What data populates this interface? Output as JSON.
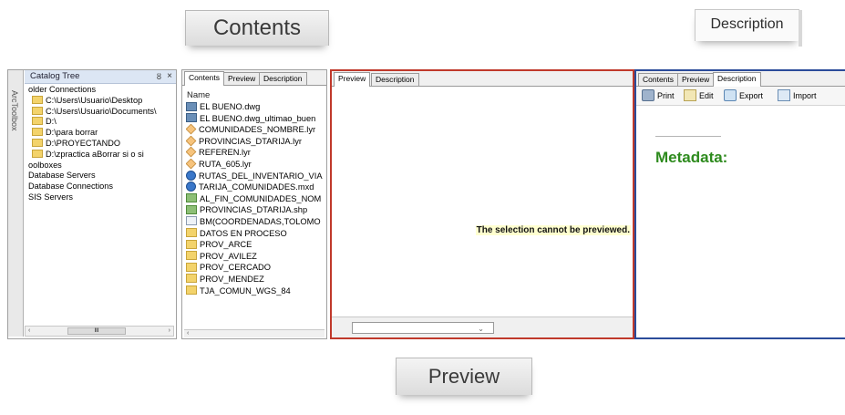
{
  "zoomed_labels": {
    "contents": "Contents",
    "description": "Description",
    "preview": "Preview"
  },
  "catalog": {
    "toolbox_label": "ArcToolbox",
    "title": "Catalog Tree",
    "pin": "ȣ",
    "close": "×",
    "items": [
      {
        "label": "older Connections",
        "icon": "none"
      },
      {
        "label": "C:\\Users\\Usuario\\Desktop",
        "icon": "folder-icon"
      },
      {
        "label": "C:\\Users\\Usuario\\Documents\\",
        "icon": "folder-icon"
      },
      {
        "label": "D:\\",
        "icon": "folder-icon"
      },
      {
        "label": "D:\\para borrar",
        "icon": "folder-icon"
      },
      {
        "label": "D:\\PROYECTANDO",
        "icon": "folder-icon"
      },
      {
        "label": "D:\\zpractica aBorrar si o si",
        "icon": "folder-icon"
      },
      {
        "label": "oolboxes",
        "icon": "none"
      },
      {
        "label": "Database Servers",
        "icon": "none"
      },
      {
        "label": "Database Connections",
        "icon": "none"
      },
      {
        "label": "SIS Servers",
        "icon": "none"
      }
    ],
    "scroll_left": "‹",
    "scroll_right": "›",
    "scroll_thumb": "III"
  },
  "contents_panel": {
    "tabs": [
      "Contents",
      "Preview",
      "Description"
    ],
    "active_tab": "Contents",
    "column_header": "Name",
    "items": [
      {
        "label": "EL BUENO.dwg",
        "icon": "dwg"
      },
      {
        "label": "EL BUENO.dwg_ultimao_buen",
        "icon": "dwg"
      },
      {
        "label": "COMUNIDADES_NOMBRE.lyr",
        "icon": "lyr"
      },
      {
        "label": "PROVINCIAS_DTARIJA.lyr",
        "icon": "lyr"
      },
      {
        "label": "REFEREN.lyr",
        "icon": "lyr"
      },
      {
        "label": "RUTA_605.lyr",
        "icon": "lyr"
      },
      {
        "label": "RUTAS_DEL_INVENTARIO_VIA",
        "icon": "mxd"
      },
      {
        "label": "TARIJA_COMUNIDADES.mxd",
        "icon": "mxd"
      },
      {
        "label": "AL_FIN_COMUNIDADES_NOM",
        "icon": "shp"
      },
      {
        "label": "PROVINCIAS_DTARIJA.shp",
        "icon": "shp"
      },
      {
        "label": "BM(COORDENADAS,TOLOMO",
        "icon": "bm"
      },
      {
        "label": "DATOS EN PROCESO",
        "icon": "fold"
      },
      {
        "label": "PROV_ARCE",
        "icon": "fold"
      },
      {
        "label": "PROV_AVILEZ",
        "icon": "fold"
      },
      {
        "label": "PROV_CERCADO",
        "icon": "fold"
      },
      {
        "label": "PROV_MENDEZ",
        "icon": "fold"
      },
      {
        "label": "TJA_COMUN_WGS_84",
        "icon": "fold"
      }
    ],
    "scroll_left": "‹"
  },
  "preview_panel": {
    "tabs": [
      "Preview",
      "Description"
    ],
    "active_tab": "Preview",
    "message": "The selection cannot be previewed.",
    "dropdown_value": "",
    "dropdown_arrow": "⌄"
  },
  "description_panel": {
    "tabs": [
      "Contents",
      "Preview",
      "Description"
    ],
    "active_tab": "Description",
    "toolbar": {
      "print": "Print",
      "edit": "Edit",
      "export": "Export",
      "import": "Import"
    },
    "metadata_heading": "Metadata:",
    "colors": {
      "heading": "#2e8b1e",
      "border": "#2b4c9a"
    }
  },
  "colors": {
    "preview_border": "#c0392b",
    "description_border": "#2b4c9a",
    "message_highlight": "#ffffcf"
  }
}
